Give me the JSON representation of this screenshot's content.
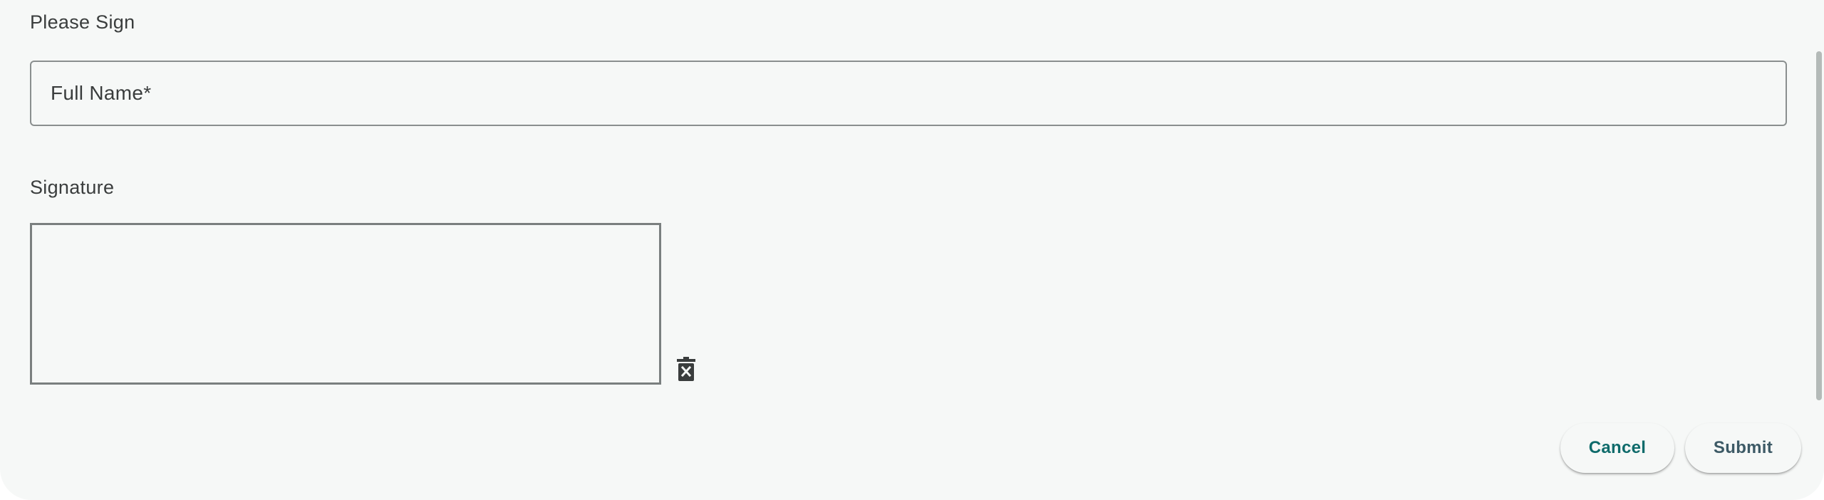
{
  "form": {
    "title": "Please Sign",
    "full_name": {
      "placeholder": "Full Name*",
      "value": ""
    },
    "signature_label": "Signature",
    "clear_icon": "delete-forever-icon"
  },
  "actions": {
    "cancel_label": "Cancel",
    "submit_label": "Submit"
  },
  "colors": {
    "background": "#f6f8f7",
    "cancel_text": "#0f6b6b",
    "submit_text": "#3d5a66",
    "border": "#8a8f8f"
  }
}
